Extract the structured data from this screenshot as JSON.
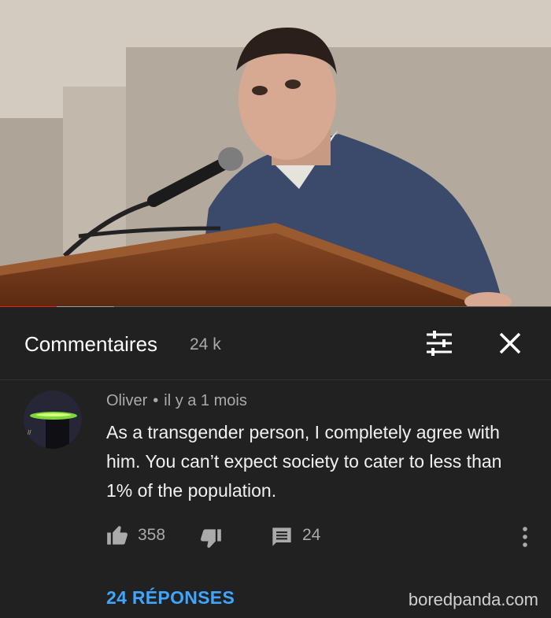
{
  "video": {
    "thumbnail_icon": "speaker-at-podium-image",
    "progress_played_fraction": 0.103,
    "progress_buffered_fraction": 0.207,
    "accent_color": "#e62117"
  },
  "header": {
    "title": "Commentaires",
    "count": "24 k",
    "filter_icon": "sort-filter-icon",
    "close_icon": "close-icon"
  },
  "comment": {
    "author": "Oliver",
    "separator": "•",
    "time": "il y a 1 mois",
    "text": "As a transgender person, I completely agree with him. You can’t expect society to cater to less than 1% of the population.",
    "likes": "358",
    "replies_count": "24",
    "replies_label": "24 RÉPONSES",
    "link_color": "#3ea6ff"
  },
  "watermark": "boredpanda.com"
}
